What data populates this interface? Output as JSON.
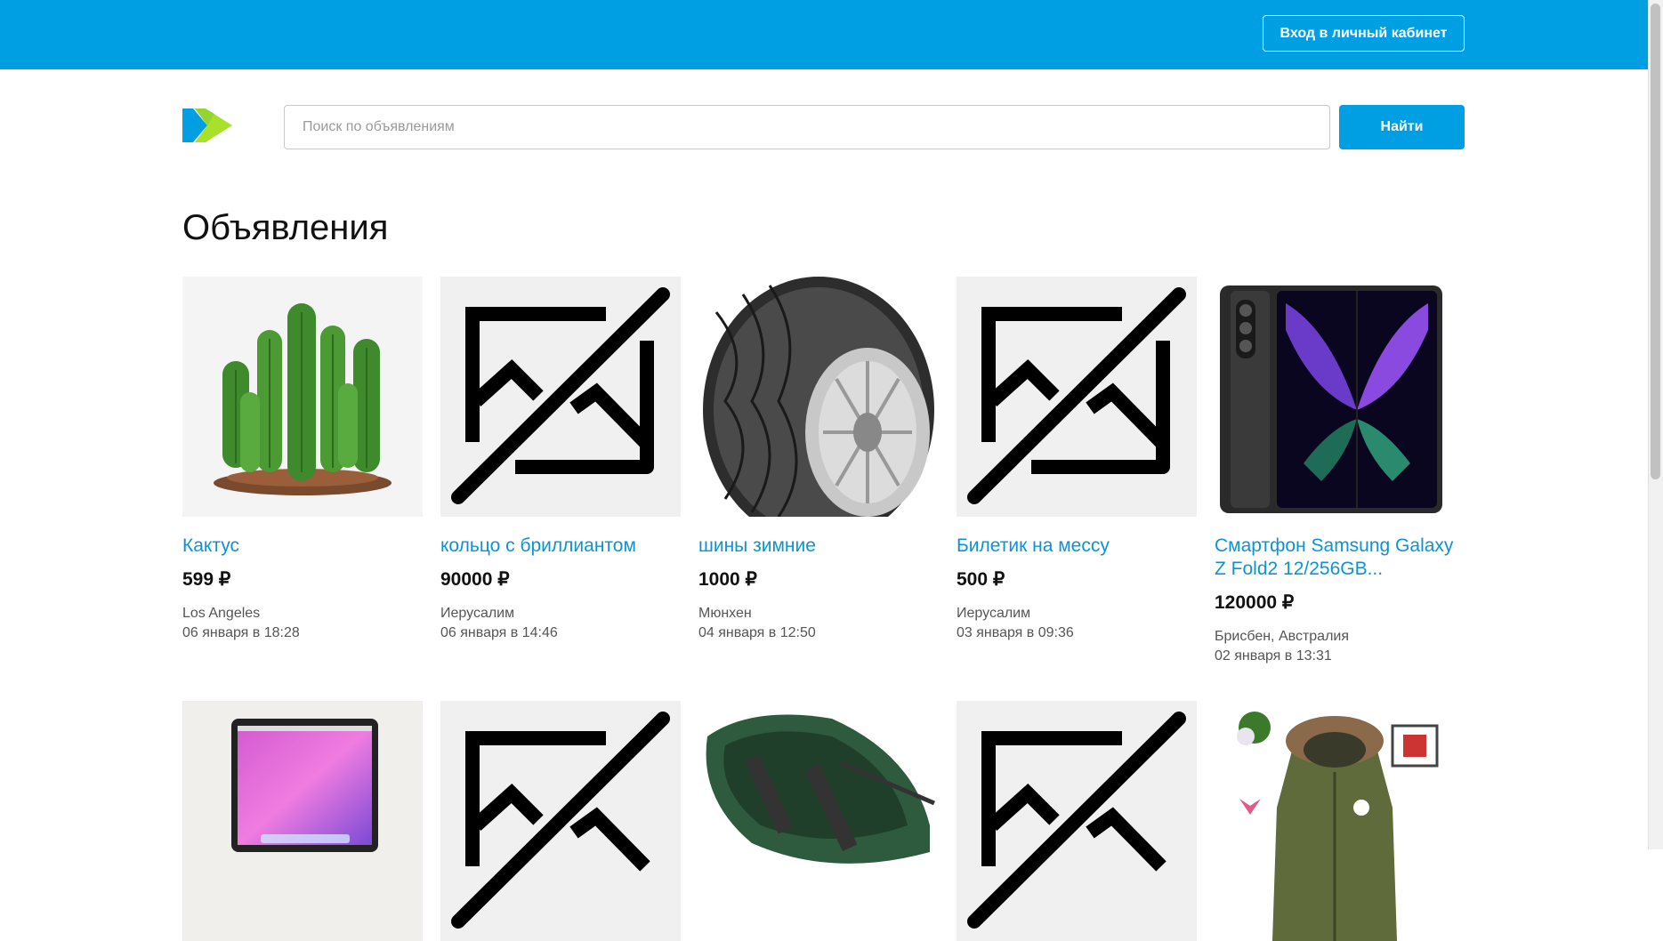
{
  "header": {
    "login_label": "Вход в личный кабинет",
    "brand_colors": {
      "primary": "#009ee3",
      "accent": "#a8e02a"
    }
  },
  "search": {
    "placeholder": "Поиск по объявлениям",
    "value": "",
    "button_label": "Найти"
  },
  "page_title": "Объявления",
  "listings": [
    {
      "title": "Кактус",
      "price": "599 ₽",
      "city": "Los Angeles",
      "date": "06 января в 18:28",
      "image": "cactus"
    },
    {
      "title": "кольцо с бриллиантом",
      "price": "90000 ₽",
      "city": "Иерусалим",
      "date": "06 января в 14:46",
      "image": "no-image"
    },
    {
      "title": "шины зимние",
      "price": "1000 ₽",
      "city": "Мюнхен",
      "date": "04 января в 12:50",
      "image": "tire"
    },
    {
      "title": "Билетик на мессу",
      "price": "500 ₽",
      "city": "Иерусалим",
      "date": "03 января в 09:36",
      "image": "no-image"
    },
    {
      "title": "Смартфон Samsung Galaxy Z Fold2 12/256GB...",
      "price": "120000 ₽",
      "city": "Брисбен, Австралия",
      "date": "02 января в 13:31",
      "image": "phone"
    },
    {
      "image": "laptop"
    },
    {
      "image": "no-image"
    },
    {
      "image": "boat"
    },
    {
      "image": "no-image"
    },
    {
      "image": "jacket"
    }
  ]
}
